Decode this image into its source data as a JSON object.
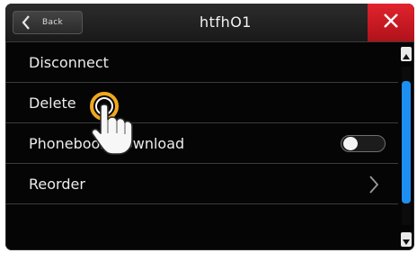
{
  "header": {
    "back_label": "Back",
    "title": "htfhO1"
  },
  "menu": {
    "items": [
      {
        "label": "Disconnect"
      },
      {
        "label": "Delete"
      },
      {
        "label": "Phonebook Download",
        "toggle_on": false
      },
      {
        "label": "Reorder"
      }
    ]
  },
  "colors": {
    "close_red": "#d4111c",
    "scroll_blue": "#1e8ff0",
    "touch_ring": "#f0a81e"
  },
  "icons": {
    "back": "chevron-left-icon",
    "close": "close-icon",
    "reorder_arrow": "chevron-right-icon",
    "scroll_up": "triangle-up-icon",
    "scroll_down": "triangle-down-icon",
    "pointer": "hand-pointer-icon"
  }
}
